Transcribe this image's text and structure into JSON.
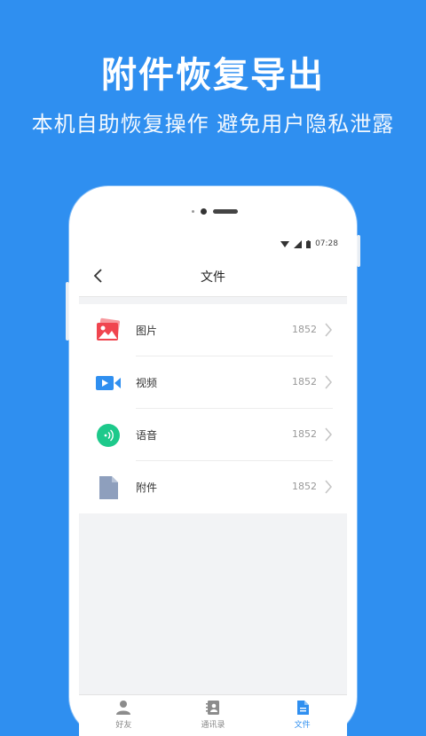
{
  "promo": {
    "title": "附件恢复导出",
    "subtitle": "本机自助恢复操作 避免用户隐私泄露"
  },
  "status_bar": {
    "time": "07:28"
  },
  "header": {
    "title": "文件"
  },
  "files": [
    {
      "label": "图片",
      "count": "1852",
      "icon": "image-icon",
      "color": "#f0454f"
    },
    {
      "label": "视频",
      "count": "1852",
      "icon": "video-icon",
      "color": "#2f8ff0"
    },
    {
      "label": "语音",
      "count": "1852",
      "icon": "audio-icon",
      "color": "#1dc98b"
    },
    {
      "label": "附件",
      "count": "1852",
      "icon": "document-icon",
      "color": "#8e9fbd"
    }
  ],
  "tabs": [
    {
      "label": "好友",
      "icon": "person-icon",
      "active": false
    },
    {
      "label": "通讯录",
      "icon": "contacts-icon",
      "active": false
    },
    {
      "label": "文件",
      "icon": "file-icon",
      "active": true
    }
  ],
  "colors": {
    "accent": "#2f8ff0",
    "background": "#2f8ff0"
  }
}
